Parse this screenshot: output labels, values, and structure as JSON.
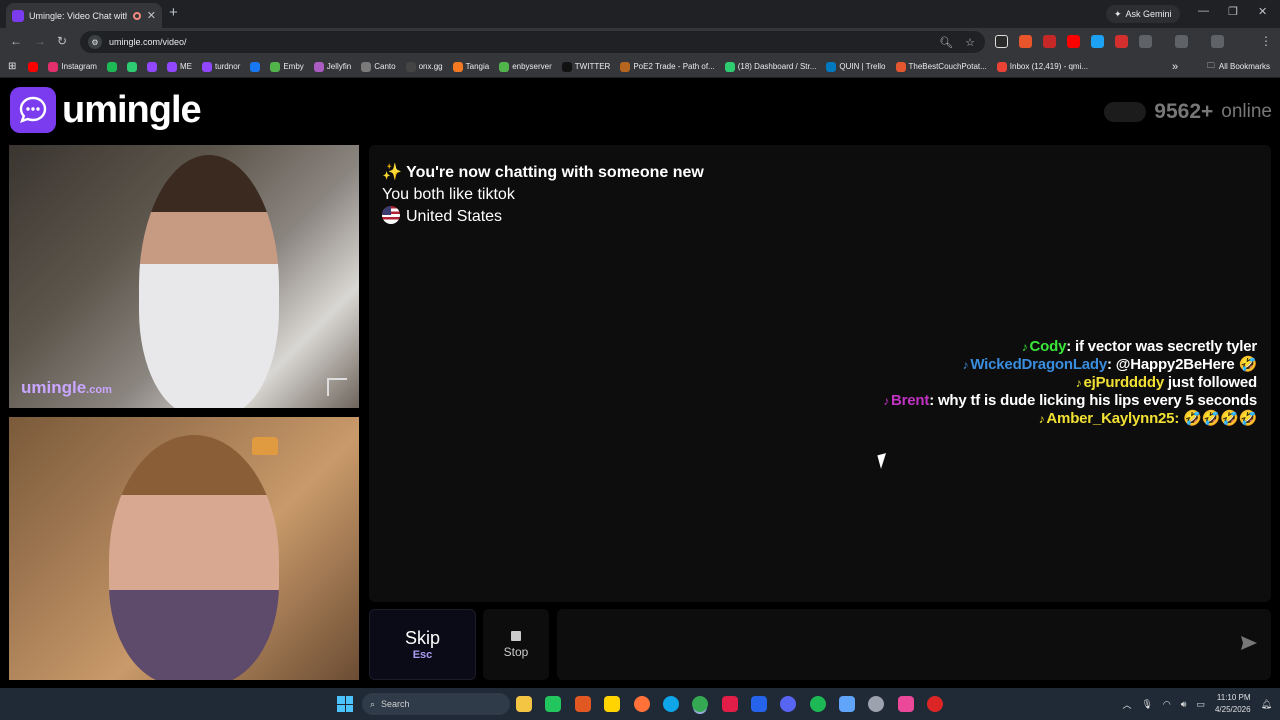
{
  "browser": {
    "tab_title": "Umingle: Video Chat with S",
    "new_tab": "+",
    "gemini_label": "Ask Gemini",
    "url": "umingle.com/video/",
    "window_controls": {
      "minimize": "—",
      "maximize": "❐",
      "close": "✕"
    },
    "bookmarks": [
      {
        "label": "",
        "color": "#ff0000"
      },
      {
        "label": "Instagram",
        "color": "#e1306c"
      },
      {
        "label": "",
        "color": "#1db954"
      },
      {
        "label": "",
        "color": "#2ecc71"
      },
      {
        "label": "",
        "color": "#9146ff"
      },
      {
        "label": "ME",
        "color": "#9146ff"
      },
      {
        "label": "turdnor",
        "color": "#9146ff"
      },
      {
        "label": "",
        "color": "#1877f2"
      },
      {
        "label": "Emby",
        "color": "#52b54b"
      },
      {
        "label": "Jellyfin",
        "color": "#aa5cc3"
      },
      {
        "label": "Canto",
        "color": "#7a7a7a"
      },
      {
        "label": "onx.gg",
        "color": "#444"
      },
      {
        "label": "Tangia",
        "color": "#f47920"
      },
      {
        "label": "enbyserver",
        "color": "#52b54b"
      },
      {
        "label": "TWITTER",
        "color": "#111"
      },
      {
        "label": "PoE2 Trade - Path of...",
        "color": "#b5651d"
      },
      {
        "label": "(18) Dashboard / Str...",
        "color": "#2ecc71"
      },
      {
        "label": "QUIN | Trello",
        "color": "#0079bf"
      },
      {
        "label": "TheBestCouchPotat...",
        "color": "#e4572e"
      },
      {
        "label": "Inbox (12,419) - qmi...",
        "color": "#ea4335"
      }
    ],
    "all_bookmarks": "All Bookmarks"
  },
  "site": {
    "logo_text": "umingle",
    "online_count": "9562+",
    "online_label": "online"
  },
  "video": {
    "watermark_main": "umingle",
    "watermark_suffix": ".com"
  },
  "chat": {
    "intro_emoji": "✨",
    "intro": "You're now chatting with someone new",
    "interests": "You both like tiktok",
    "country": "United States"
  },
  "tiktok_messages": [
    {
      "user": "Cody",
      "user_color": "#39e639",
      "text": ": if vector was secretly tyler",
      "text_color": "#ffffff"
    },
    {
      "user": "WickedDragonLady",
      "user_color": "#3a8dde",
      "text": ": @Happy2BeHere 🤣",
      "text_color": "#ffffff"
    },
    {
      "user": "ejPurddddy",
      "user_color": "#f1e033",
      "text": " just followed",
      "text_color": "#ffffff"
    },
    {
      "user": "Brent",
      "user_color": "#c232c2",
      "text": ": why tf is dude licking his lips every 5 seconds",
      "text_color": "#ffffff"
    },
    {
      "user": "Amber_Kaylynn25",
      "user_color": "#f1e033",
      "text": ": 🤣🤣🤣🤣",
      "text_color": "#f1e033"
    }
  ],
  "controls": {
    "skip_label": "Skip",
    "skip_shortcut": "Esc",
    "stop_label": "Stop",
    "message_placeholder": ""
  },
  "taskbar": {
    "search_label": "Search",
    "time": "11:10 PM",
    "date": "4/25/2026"
  }
}
